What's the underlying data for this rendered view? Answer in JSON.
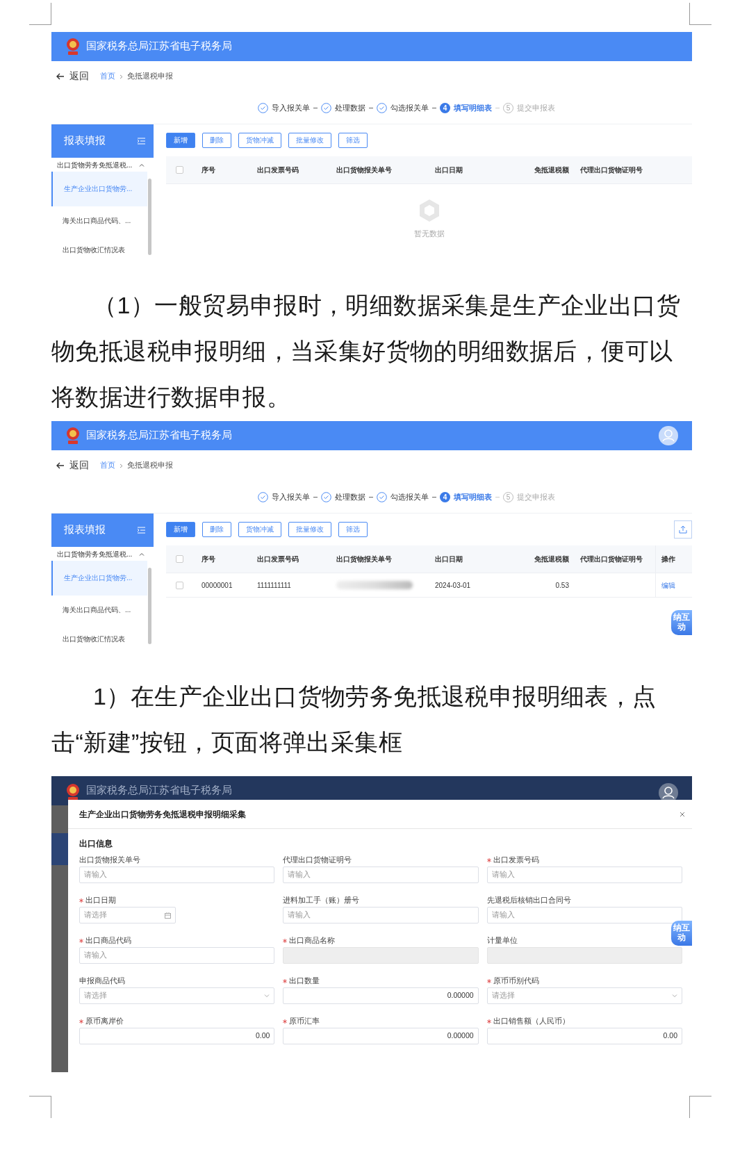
{
  "figures": [
    {
      "kind": "list",
      "header": {
        "title": "国家税务总局江苏省电子税务局"
      },
      "back": "返回",
      "breadcrumb": [
        "首页",
        "免抵退税申报"
      ],
      "steps": [
        {
          "label": "导入报关单",
          "done": true,
          "active": false
        },
        {
          "label": "处理数据",
          "done": true,
          "active": false
        },
        {
          "label": "勾选报关单",
          "done": true,
          "active": false
        },
        {
          "num": "4",
          "label": "填写明细表",
          "done": false,
          "active": true
        },
        {
          "num": "5",
          "label": "提交申报表",
          "done": false,
          "active": false
        }
      ],
      "sidebar": {
        "title": "报表填报",
        "group": "出口货物劳务免抵退税...",
        "expanded": true,
        "items": [
          {
            "label": "生产企业出口货物劳...",
            "selected": true
          },
          {
            "label": "海关出口商品代码、...",
            "selected": false
          },
          {
            "label": "出口货物收汇情况表",
            "selected": false
          }
        ]
      },
      "toolbar": [
        {
          "label": "新增",
          "primary": true
        },
        {
          "label": "删除",
          "primary": false
        },
        {
          "label": "货物冲减",
          "primary": false
        },
        {
          "label": "批量修改",
          "primary": false
        },
        {
          "label": "筛选",
          "primary": false
        }
      ],
      "table": {
        "all_checked": false,
        "columns": [
          {
            "label": "序号",
            "numeric": false
          },
          {
            "label": "出口发票号码",
            "numeric": false
          },
          {
            "label": "出口货物报关单号",
            "numeric": false
          },
          {
            "label": "出口日期",
            "numeric": false
          },
          {
            "label": "免抵退税额",
            "numeric": true
          },
          {
            "label": "代理出口货物证明号",
            "numeric": false
          }
        ]
      },
      "empty_text": "暂无数据"
    },
    {
      "kind": "list",
      "header": {
        "title": "国家税务总局江苏省电子税务局",
        "avatar": true
      },
      "back": "返回",
      "breadcrumb": [
        "首页",
        "免抵退税申报"
      ],
      "steps": [
        {
          "label": "导入报关单",
          "done": true,
          "active": false
        },
        {
          "label": "处理数据",
          "done": true,
          "active": false
        },
        {
          "label": "勾选报关单",
          "done": true,
          "active": false
        },
        {
          "num": "4",
          "label": "填写明细表",
          "done": false,
          "active": true
        },
        {
          "num": "5",
          "label": "提交申报表",
          "done": false,
          "active": false
        }
      ],
      "sidebar": {
        "title": "报表填报",
        "group": "出口货物劳务免抵退税...",
        "expanded": true,
        "items": [
          {
            "label": "生产企业出口货物劳...",
            "selected": true
          },
          {
            "label": "海关出口商品代码、...",
            "selected": false
          },
          {
            "label": "出口货物收汇情况表",
            "selected": false
          }
        ]
      },
      "toolbar": [
        {
          "label": "新增",
          "primary": true
        },
        {
          "label": "删除",
          "primary": false
        },
        {
          "label": "货物冲减",
          "primary": false
        },
        {
          "label": "批量修改",
          "primary": false
        },
        {
          "label": "筛选",
          "primary": false
        }
      ],
      "export_button": true,
      "table": {
        "all_checked": false,
        "columns": [
          {
            "label": "序号",
            "numeric": false
          },
          {
            "label": "出口发票号码",
            "numeric": false
          },
          {
            "label": "出口货物报关单号",
            "numeric": false
          },
          {
            "label": "出口日期",
            "numeric": false
          },
          {
            "label": "免抵退税额",
            "numeric": true
          },
          {
            "label": "代理出口货物证明号",
            "numeric": false
          },
          {
            "label": "操作",
            "numeric": false
          }
        ],
        "rows": [
          {
            "checked": false,
            "cells": [
              {
                "kind": "text",
                "text": "00000001"
              },
              {
                "kind": "text",
                "text": "1111111111"
              },
              {
                "kind": "blurred"
              },
              {
                "kind": "text",
                "text": "2024-03-01"
              },
              {
                "kind": "text",
                "text": "0.53"
              },
              {
                "kind": "empty"
              },
              {
                "kind": "link",
                "text": "编辑"
              }
            ]
          }
        ]
      },
      "helper": "纳互动"
    },
    {
      "kind": "dialog",
      "backdrop_title": "国家税务总局江苏省电子税务局",
      "avatar": true,
      "helper": "纳互动",
      "title": "生产企业出口货物劳务免抵退税申报明细采集",
      "section": "出口信息",
      "fields": [
        {
          "label": "出口货物报关单号",
          "kind": "input",
          "placeholder": "请输入"
        },
        {
          "label": "代理出口货物证明号",
          "kind": "input",
          "placeholder": "请输入"
        },
        {
          "label": "出口发票号码",
          "required": true,
          "kind": "input",
          "placeholder": "请输入"
        },
        {
          "label": "出口日期",
          "required": true,
          "kind": "date",
          "placeholder": "请选择"
        },
        {
          "label": "进料加工手（账）册号",
          "kind": "input",
          "placeholder": "请输入"
        },
        {
          "label": "先退税后核销出口合同号",
          "kind": "input",
          "placeholder": "请输入"
        },
        {
          "label": "出口商品代码",
          "required": true,
          "kind": "input",
          "placeholder": "请输入"
        },
        {
          "label": "出口商品名称",
          "required": true,
          "kind": "disabled"
        },
        {
          "label": "计量单位",
          "kind": "disabled"
        },
        {
          "label": "申报商品代码",
          "kind": "select",
          "placeholder": "请选择"
        },
        {
          "label": "出口数量",
          "required": true,
          "kind": "number",
          "value": "0.00000"
        },
        {
          "label": "原币币别代码",
          "required": true,
          "kind": "select",
          "placeholder": "请选择"
        },
        {
          "label": "原币离岸价",
          "required": true,
          "kind": "number",
          "value": "0.00"
        },
        {
          "label": "原币汇率",
          "required": true,
          "kind": "number",
          "value": "0.00000"
        },
        {
          "label": "出口销售额（人民币）",
          "required": true,
          "kind": "number",
          "value": "0.00"
        }
      ]
    }
  ],
  "paragraphs": [
    "（1）一般贸易申报时，明细数据采集是生产企业出口货物免抵退税申报明细，当采集好货物的明细数据后，便可以将数据进行数据申报。",
    "1）在生产企业出口货物劳务免抵退税申报明细表，点击“新建”按钮，页面将弹出采集框"
  ]
}
